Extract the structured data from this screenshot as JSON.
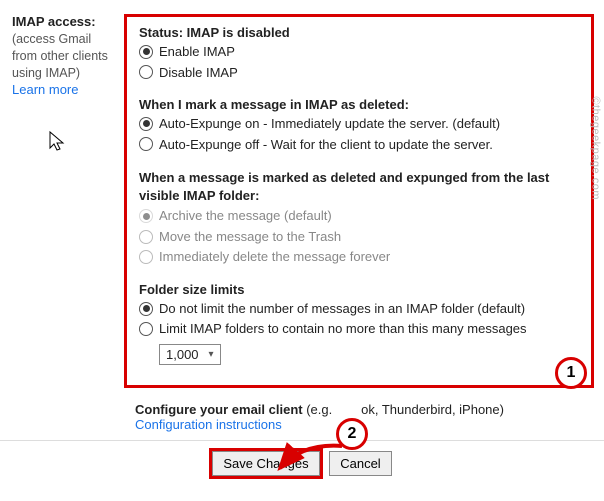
{
  "left": {
    "title": "IMAP access:",
    "desc": "(access Gmail from other clients using IMAP)",
    "learn": "Learn more"
  },
  "status": {
    "heading": "Status: IMAP is disabled",
    "enable": "Enable IMAP",
    "disable": "Disable IMAP"
  },
  "mark": {
    "heading": "When I mark a message in IMAP as deleted:",
    "opt1": "Auto-Expunge on - Immediately update the server. (default)",
    "opt2": "Auto-Expunge off - Wait for the client to update the server."
  },
  "expunged": {
    "heading": "When a message is marked as deleted and expunged from the last visible IMAP folder:",
    "opt1": "Archive the message (default)",
    "opt2": "Move the message to the Trash",
    "opt3": "Immediately delete the message forever"
  },
  "limits": {
    "heading": "Folder size limits",
    "opt1": "Do not limit the number of messages in an IMAP folder (default)",
    "opt2": "Limit IMAP folders to contain no more than this many messages",
    "select": "1,000"
  },
  "config": {
    "heading_pre": "Configure your email client",
    "heading_post": "ok, Thunderbird, iPhone)",
    "heading_mid": " (e.g.",
    "link": "Configuration instructions"
  },
  "buttons": {
    "save": "Save Changes",
    "cancel": "Cancel"
  },
  "callouts": {
    "c1": "1",
    "c2": "2"
  },
  "watermark": "©thegeekpage.com"
}
